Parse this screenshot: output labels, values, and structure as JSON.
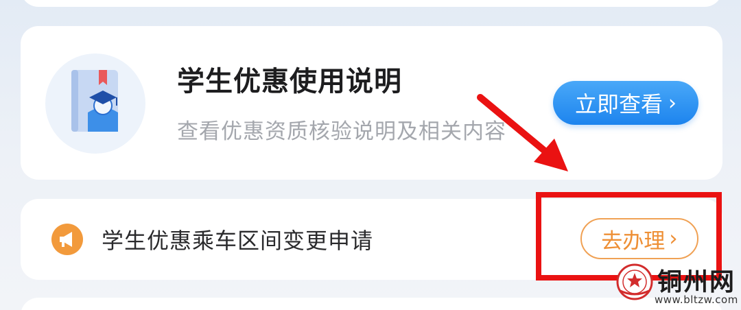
{
  "guide_card": {
    "title": "学生优惠使用说明",
    "description": "查看优惠资质核验说明及相关内容",
    "button_label": "立即查看",
    "button_chevron": "›",
    "icon": "student-guide-book-icon"
  },
  "apply_card": {
    "title": "学生优惠乘车区间变更申请",
    "button_label": "去办理",
    "button_chevron": "›",
    "icon": "megaphone-icon"
  },
  "annotation": {
    "arrow": "red-arrow",
    "highlight": "red-box"
  },
  "watermark": {
    "name": "铜州网",
    "url": "www.bltzw.com",
    "logo": "seal-logo"
  },
  "colors": {
    "accent_blue": "#1d84ee",
    "accent_orange": "#ee8f35",
    "annotation_red": "#ea1212"
  }
}
